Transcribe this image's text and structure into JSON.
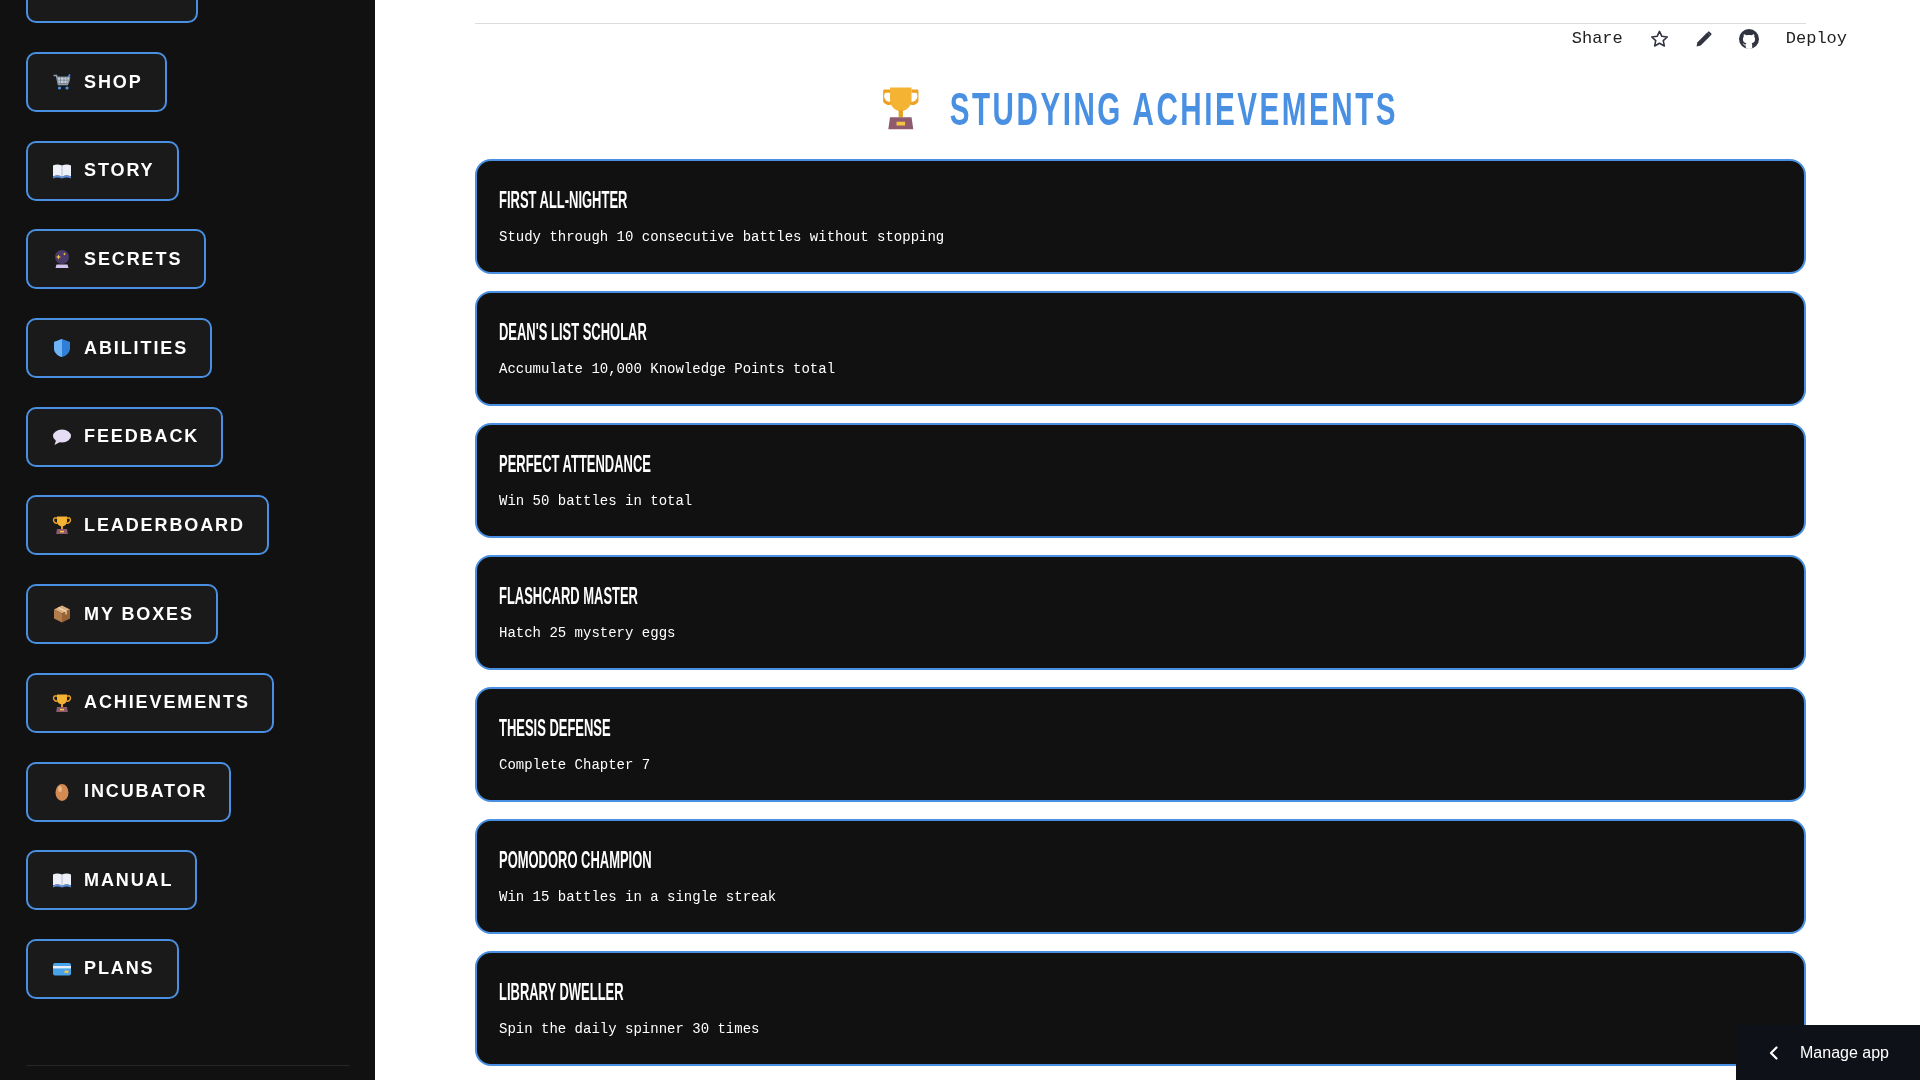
{
  "sidebar": {
    "partly_hidden_item_above": true,
    "items": [
      {
        "label": "SHOP"
      },
      {
        "label": "STORY"
      },
      {
        "label": "SECRETS"
      },
      {
        "label": "ABILITIES"
      },
      {
        "label": "FEEDBACK"
      },
      {
        "label": "LEADERBOARD"
      },
      {
        "label": "MY BOXES"
      },
      {
        "label": "ACHIEVEMENTS"
      },
      {
        "label": "INCUBATOR"
      },
      {
        "label": "MANUAL"
      },
      {
        "label": "PLANS"
      }
    ]
  },
  "toolbar": {
    "share": "Share",
    "deploy": "Deploy"
  },
  "heading": "STUDYING ACHIEVEMENTS",
  "achievements": [
    {
      "title": "FIRST ALL-NIGHTER",
      "description": "Study through 10 consecutive battles without stopping"
    },
    {
      "title": "DEAN'S LIST SCHOLAR",
      "description": "Accumulate 10,000 Knowledge Points total"
    },
    {
      "title": "PERFECT ATTENDANCE",
      "description": "Win 50 battles in total"
    },
    {
      "title": "FLASHCARD MASTER",
      "description": "Hatch 25 mystery eggs"
    },
    {
      "title": "THESIS DEFENSE",
      "description": "Complete Chapter 7"
    },
    {
      "title": "POMODORO CHAMPION",
      "description": "Win 15 battles in a single streak"
    },
    {
      "title": "LIBRARY DWELLER",
      "description": "Spin the daily spinner 30 times"
    }
  ],
  "manage_app": {
    "label": "Manage app"
  }
}
